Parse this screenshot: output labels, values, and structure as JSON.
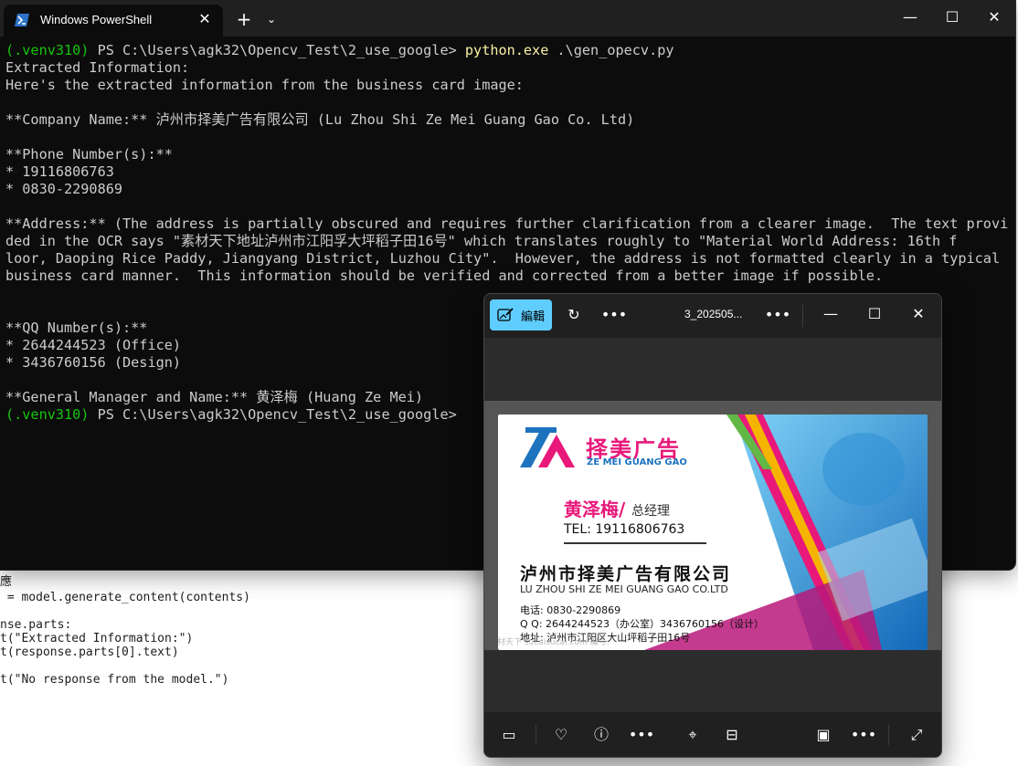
{
  "terminal": {
    "tab_title": "Windows PowerShell",
    "lines": [
      {
        "venv": "(.venv310)",
        "prompt": " PS C:\\Users\\agk32\\Opencv_Test\\2_use_google> ",
        "cmd": "python.exe",
        "args": " .\\gen_opecv.py"
      },
      {
        "text": "Extracted Information:"
      },
      {
        "text": "Here's the extracted information from the business card image:"
      },
      {
        "text": ""
      },
      {
        "text": "**Company Name:** 泸州市择美广告有限公司 (Lu Zhou Shi Ze Mei Guang Gao Co. Ltd)"
      },
      {
        "text": ""
      },
      {
        "text": "**Phone Number(s):**"
      },
      {
        "text": "* 19116806763"
      },
      {
        "text": "* 0830-2290869"
      },
      {
        "text": ""
      },
      {
        "text": "**Address:** (The address is partially obscured and requires further clarification from a clearer image.  The text provi"
      },
      {
        "text": "ded in the OCR says \"素材天下地址泸州市江阳孚大坪稻子田16号\" which translates roughly to \"Material World Address: 16th f"
      },
      {
        "text": "loor, Daoping Rice Paddy, Jiangyang District, Luzhou City\".  However, the address is not formatted clearly in a typical"
      },
      {
        "text": "business card manner.  This information should be verified and corrected from a better image if possible."
      },
      {
        "text": ""
      },
      {
        "text": ""
      },
      {
        "text": "**QQ Number(s):**"
      },
      {
        "text": "* 2644244523 (Office)"
      },
      {
        "text": "* 3436760156 (Design)"
      },
      {
        "text": ""
      },
      {
        "text": "**General Manager and Name:** 黄泽梅 (Huang Ze Mei)"
      },
      {
        "venv": "(.venv310)",
        "prompt": " PS C:\\Users\\agk32\\Opencv_Test\\2_use_google> ",
        "cmd": "",
        "args": ""
      }
    ]
  },
  "editor_bg": {
    "lines": [
      "應",
      " = model.generate_content(contents)",
      "",
      "nse.parts:",
      "t(\"Extracted Information:\")",
      "t(response.parts[0].text)",
      "",
      "t(\"No response from the model.\")"
    ]
  },
  "photos": {
    "edit_label": "編輯",
    "filename": "3_202505...",
    "card": {
      "logo_name": "择美广告",
      "logo_en": "ZE MEI GUANG GAO",
      "person": "黄泽梅/",
      "title": "总经理",
      "tel": "TEL: 19116806763",
      "company_cn": "泸州市择美广告有限公司",
      "company_en": "LU ZHOU SHI ZE MEI GUANG GAO CO.LTD",
      "phone": "电话:  0830-2290869",
      "qq": "Q Q:  2644244523（办公室）3436760156（设计）",
      "address": "地址:  泸州市江阳区大山坪稻子田16号",
      "watermark": "素材天下 sucaisucai.com 编号:"
    }
  },
  "colors": {
    "terminal_bg": "#0c0c0c",
    "venv_green": "#16c60c",
    "cmd_yellow": "#f9f1a5",
    "edit_accent": "#60cdff",
    "brand_pink": "#e8197a",
    "brand_blue": "#1e73be"
  }
}
